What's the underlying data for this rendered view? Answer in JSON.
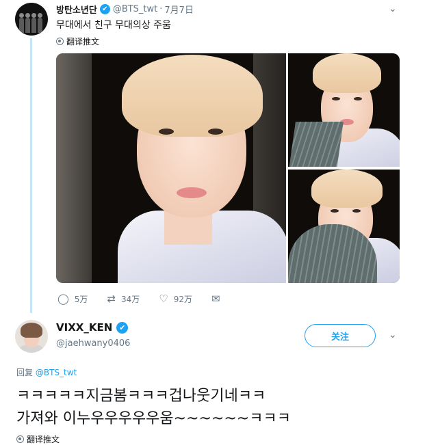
{
  "parent_tweet": {
    "display_name": "방탄소년단",
    "handle": "@BTS_twt",
    "separator": "·",
    "date": "7月7日",
    "text": "무대에서 친구 무대의상 주움",
    "translate_label": "翻译推文",
    "replies": "5万",
    "retweets": "34万",
    "likes": "92万",
    "icons": {
      "verified": "verified-badge-icon",
      "caret": "chevron-down-icon",
      "reply": "reply-icon",
      "retweet": "retweet-icon",
      "like": "heart-icon",
      "message": "envelope-icon",
      "globe": "globe-icon"
    }
  },
  "reply_tweet": {
    "display_name": "VIXX_KEN",
    "handle": "@jaehwany0406",
    "follow_label": "关注",
    "reply_prefix": "回复",
    "reply_mention": "@BTS_twt",
    "text_line1": "ㅋㅋㅋㅋㅋ지금봄ㅋㅋㅋ겁나웃기네ㅋㅋ",
    "text_line2": "가져와 이누우우우우우움~~~~~~ㅋㅋㅋ",
    "translate_label": "翻译推文"
  },
  "colors": {
    "accent": "#1da1f2",
    "muted": "#657786",
    "thread_line": "#c4e4f7",
    "text": "#14171a"
  }
}
